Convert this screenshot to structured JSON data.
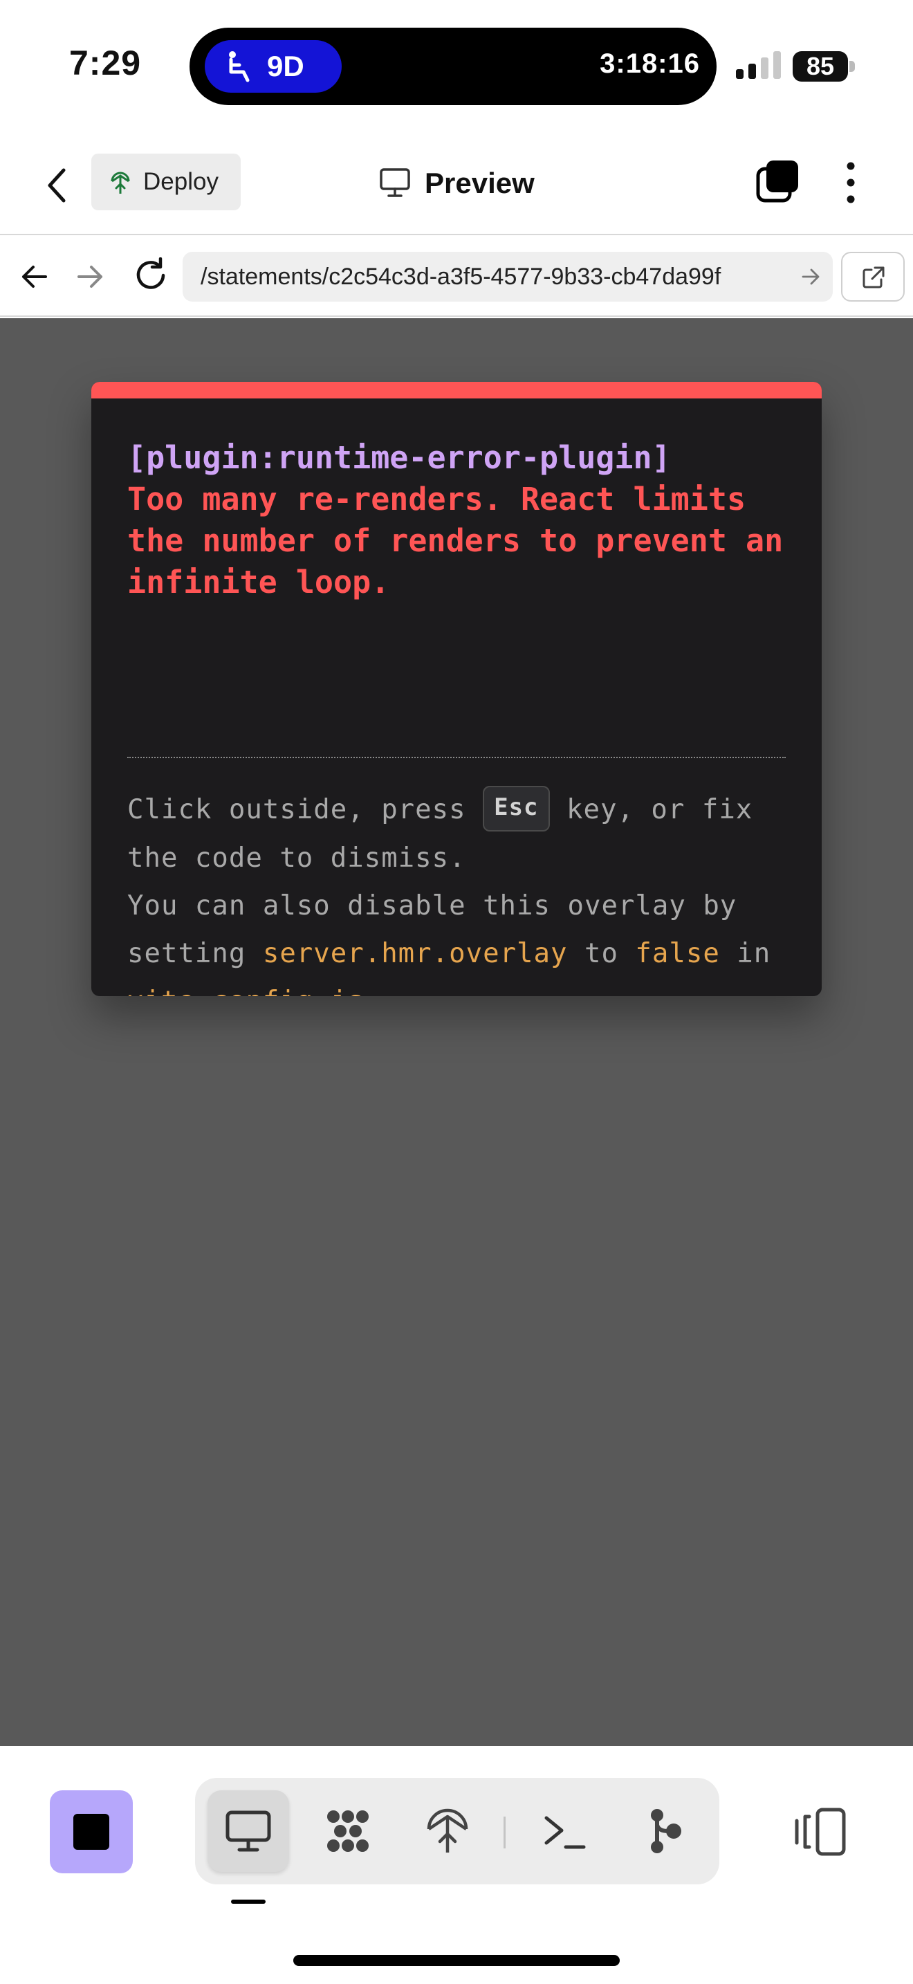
{
  "status_bar": {
    "time": "7:29",
    "activity": {
      "seat": "9D",
      "timer": "3:18:16",
      "icon": "seat-icon"
    },
    "battery": "85"
  },
  "header": {
    "back_icon": "chevron-left-icon",
    "deploy_label": "Deploy",
    "title": "Preview",
    "tabs_icon": "tabs-icon",
    "more_icon": "more-vertical-icon"
  },
  "url_bar": {
    "url": "/statements/c2c54c3d-a3f5-4577-9b33-cb47da99f",
    "icons": [
      "arrow-left-icon",
      "arrow-right-icon",
      "reload-icon",
      "external-link-icon"
    ]
  },
  "error_overlay": {
    "plugin": "[plugin:runtime-error-plugin]",
    "message": "Too many re-renders. React limits the number of renders to prevent an infinite loop.",
    "tip": {
      "p1": "Click outside, press ",
      "key": "Esc",
      "p2": " key, or fix the code to dismiss.",
      "p3": "You can also disable this overlay by setting ",
      "code1": "server.hmr.overlay",
      "p4": " to ",
      "code2": "false",
      "p5": " in",
      "code3": "vite.config.js",
      "p6": "."
    },
    "colors": {
      "accent": "#ff5555",
      "plugin": "#cfa4f5",
      "code": "#e6a54e",
      "background": "#1c1b1d"
    }
  },
  "toolbar": {
    "stop_icon": "stop-icon",
    "tools": [
      "monitor-icon",
      "workflow-icon",
      "deploy-icon",
      "terminal-icon",
      "git-icon"
    ],
    "active_tool": "monitor-icon",
    "layout_icon": "layout-toggle-icon"
  }
}
